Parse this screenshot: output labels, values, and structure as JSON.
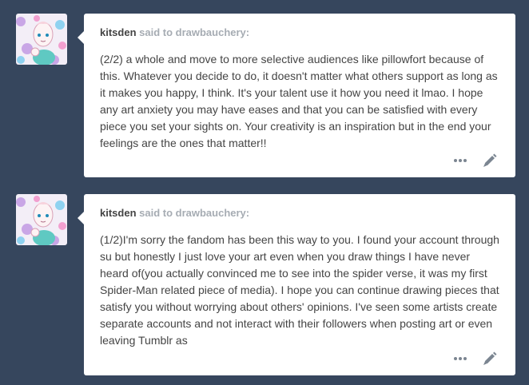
{
  "posts": [
    {
      "asker": "kitsden",
      "said_to": "said to drawbauchery:",
      "text": "(2/2) a whole and move to more selective audiences like pillowfort because of this. Whatever you decide to do, it doesn't matter what others support as long as it makes you happy, I think. It's your talent use it how you need it lmao. I hope any art anxiety you may have eases and that you can be satisfied with every piece you set your sights on. Your creativity is an inspiration but in the end your feelings are the ones that matter!!",
      "avatar_icon": "pearl-avatar",
      "controls": [
        "more-options-icon",
        "edit-icon"
      ]
    },
    {
      "asker": "kitsden",
      "said_to": "said to drawbauchery:",
      "text": "(1/2)I'm sorry the fandom has been this way to you. I found your account through su but honestly I just love your art even when you draw things I have never heard of(you actually convinced me to see into the spider verse, it was my first Spider-Man related piece of media). I hope you can continue drawing pieces that satisfy you without worrying about others' opinions. I've seen some artists create separate accounts and not interact with their followers when posting art or even leaving Tumblr as",
      "avatar_icon": "pearl-avatar",
      "controls": [
        "more-options-icon",
        "edit-icon"
      ]
    }
  ],
  "colors": {
    "background": "#36465d",
    "card": "#ffffff",
    "text": "#444444",
    "muted": "#a6acb3",
    "icon": "#7b8591"
  }
}
